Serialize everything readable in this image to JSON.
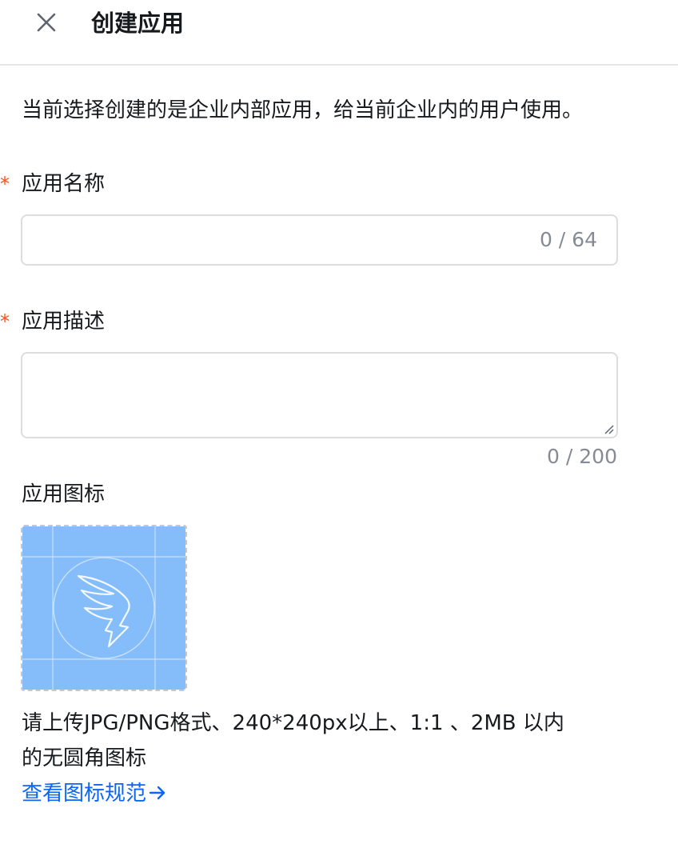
{
  "header": {
    "close_icon": "close-icon",
    "title": "创建应用"
  },
  "intro_text": "当前选择创建的是企业内部应用，给当前企业内的用户使用。",
  "required_mark": "*",
  "fields": {
    "name": {
      "label": "应用名称",
      "value": "",
      "counter": "0 / 64"
    },
    "description": {
      "label": "应用描述",
      "value": "",
      "counter": "0 / 200"
    },
    "icon": {
      "label": "应用图标",
      "placeholder_icon": "dingtalk-wing-icon",
      "hint_line1": "请上传JPG/PNG格式、240*240px以上、1:1 、2MB 以内",
      "hint_line2": "的无圆角图标",
      "link_label": "查看图标规范",
      "link_arrow_icon": "arrow-right-icon"
    }
  },
  "colors": {
    "accent": "#0b66f5",
    "required": "#ff5219",
    "placeholder_blue": "#84bdfa",
    "muted_text": "#858a94",
    "border": "#dcdde0"
  }
}
